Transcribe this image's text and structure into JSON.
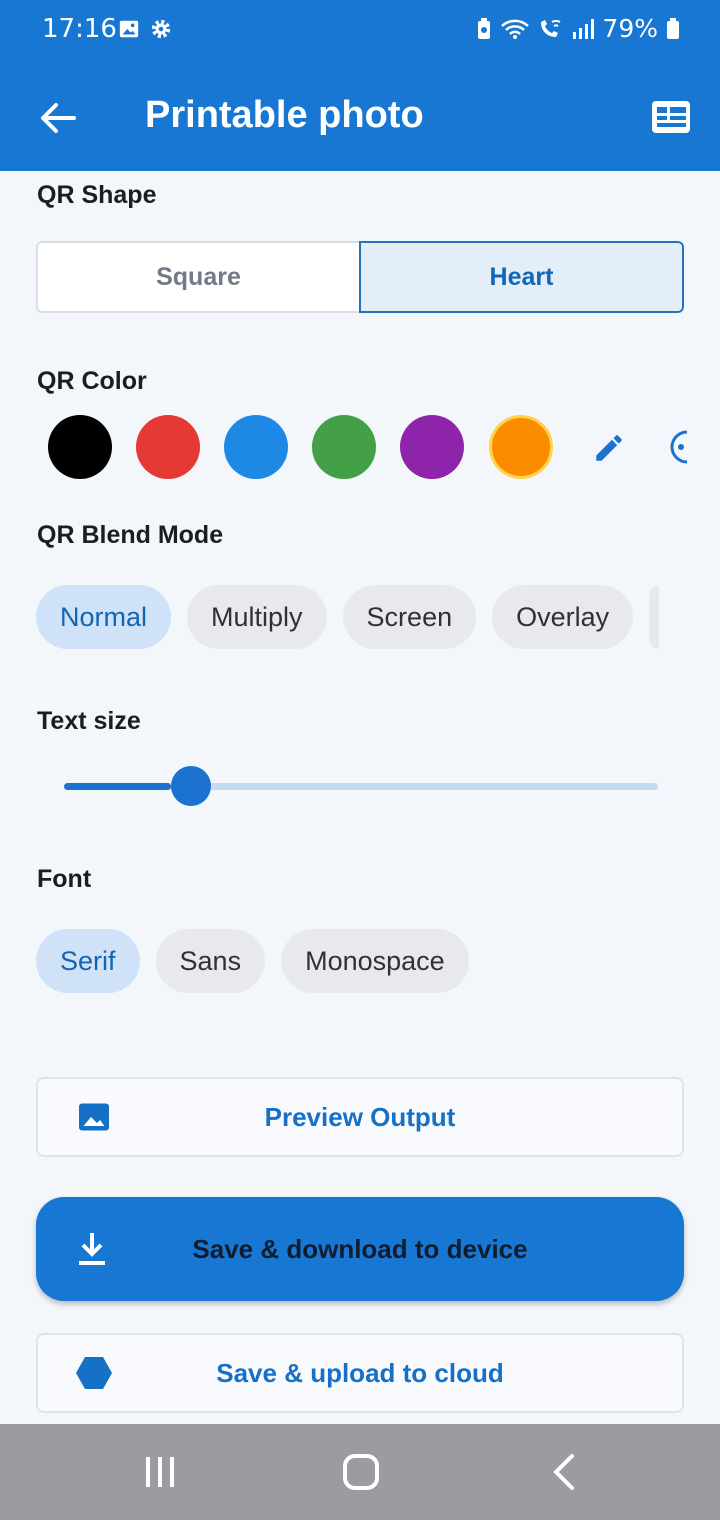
{
  "status": {
    "time": "17:16",
    "battery": "79%",
    "icons": [
      "image-icon",
      "gear-icon",
      "battery-saver-icon",
      "wifi-icon",
      "wifi-call-icon",
      "signal-icon",
      "battery-icon"
    ]
  },
  "appbar": {
    "title": "Printable photo",
    "icons": [
      "back-arrow-icon",
      "view-list-icon"
    ]
  },
  "qr_shape": {
    "title": "QR Shape",
    "options": [
      "Square",
      "Heart"
    ],
    "selected": "Heart"
  },
  "qr_color": {
    "title": "QR Color",
    "colors": [
      "#000000",
      "#e53935",
      "#1e88e5",
      "#43a047",
      "#8e24aa",
      "#fb8c00"
    ],
    "selected_color": "#fb8c00",
    "tools": [
      "edit-pencil-icon",
      "color-picker-icon"
    ]
  },
  "blend_mode": {
    "title": "QR Blend Mode",
    "options": [
      "Normal",
      "Multiply",
      "Screen",
      "Overlay"
    ],
    "selected": "Normal"
  },
  "text_size": {
    "title": "Text size",
    "value_fraction": 0.18
  },
  "font": {
    "title": "Font",
    "options": [
      "Serif",
      "Sans",
      "Monospace"
    ],
    "selected": "Serif"
  },
  "actions": {
    "preview": "Preview Output",
    "download": "Save & download to device",
    "upload": "Save & upload to cloud"
  },
  "colors": {
    "primary": "#1877d2",
    "background": "#f3f7fc"
  }
}
